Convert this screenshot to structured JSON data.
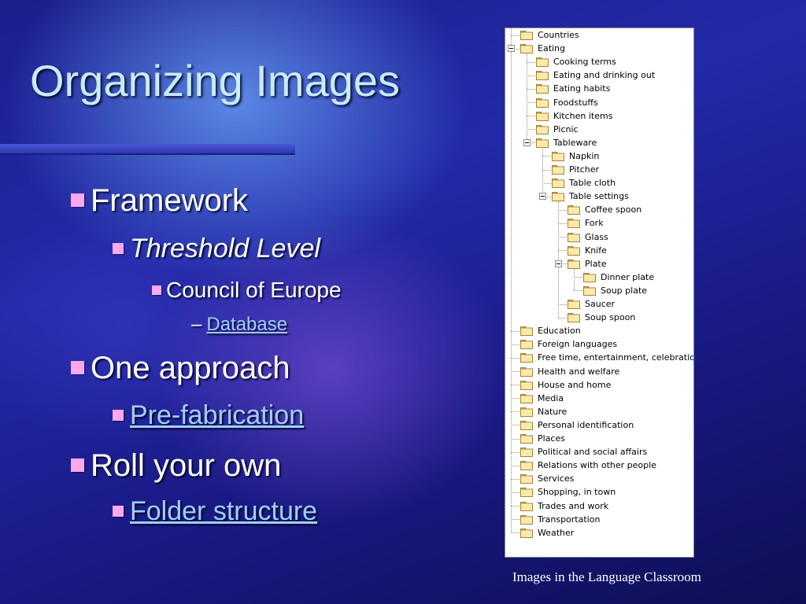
{
  "slide": {
    "title": "Organizing Images",
    "footer": "Images in the Language Classroom"
  },
  "bullets": {
    "framework": "Framework",
    "threshold": "Threshold Level",
    "council": "Council of Europe",
    "database": "Database",
    "one_approach": "One approach",
    "prefab": "Pre-fabrication",
    "roll_your_own": "Roll your own",
    "folder_structure": "Folder structure"
  },
  "colors": {
    "title_text": "#c9ecff",
    "bullet_square": "#ffa8ee",
    "link": "#9fd0ff",
    "background": "#1f25a0"
  },
  "tree": [
    {
      "label": "Countries",
      "depth": 0,
      "expanded": false
    },
    {
      "label": "Eating",
      "depth": 0,
      "expanded": true
    },
    {
      "label": "Cooking terms",
      "depth": 1,
      "expanded": false
    },
    {
      "label": "Eating and drinking out",
      "depth": 1,
      "expanded": false
    },
    {
      "label": "Eating habits",
      "depth": 1,
      "expanded": false
    },
    {
      "label": "Foodstuffs",
      "depth": 1,
      "expanded": false
    },
    {
      "label": "Kitchen items",
      "depth": 1,
      "expanded": false
    },
    {
      "label": "Picnic",
      "depth": 1,
      "expanded": false
    },
    {
      "label": "Tableware",
      "depth": 1,
      "expanded": true
    },
    {
      "label": "Napkin",
      "depth": 2,
      "expanded": false
    },
    {
      "label": "Pitcher",
      "depth": 2,
      "expanded": false
    },
    {
      "label": "Table cloth",
      "depth": 2,
      "expanded": false
    },
    {
      "label": "Table settings",
      "depth": 2,
      "expanded": true
    },
    {
      "label": "Coffee spoon",
      "depth": 3,
      "expanded": false
    },
    {
      "label": "Fork",
      "depth": 3,
      "expanded": false
    },
    {
      "label": "Glass",
      "depth": 3,
      "expanded": false
    },
    {
      "label": "Knife",
      "depth": 3,
      "expanded": false
    },
    {
      "label": "Plate",
      "depth": 3,
      "expanded": true
    },
    {
      "label": "Dinner plate",
      "depth": 4,
      "expanded": false
    },
    {
      "label": "Soup plate",
      "depth": 4,
      "expanded": false
    },
    {
      "label": "Saucer",
      "depth": 3,
      "expanded": false
    },
    {
      "label": "Soup spoon",
      "depth": 3,
      "expanded": false
    },
    {
      "label": "Education",
      "depth": 0,
      "expanded": false
    },
    {
      "label": "Foreign languages",
      "depth": 0,
      "expanded": false
    },
    {
      "label": "Free time, entertainment, celebrations",
      "depth": 0,
      "expanded": false
    },
    {
      "label": "Health and welfare",
      "depth": 0,
      "expanded": false
    },
    {
      "label": "House and home",
      "depth": 0,
      "expanded": false
    },
    {
      "label": "Media",
      "depth": 0,
      "expanded": false
    },
    {
      "label": "Nature",
      "depth": 0,
      "expanded": false
    },
    {
      "label": "Personal identification",
      "depth": 0,
      "expanded": false
    },
    {
      "label": "Places",
      "depth": 0,
      "expanded": false
    },
    {
      "label": "Political and social affairs",
      "depth": 0,
      "expanded": false
    },
    {
      "label": "Relations with other people",
      "depth": 0,
      "expanded": false
    },
    {
      "label": "Services",
      "depth": 0,
      "expanded": false
    },
    {
      "label": "Shopping, in town",
      "depth": 0,
      "expanded": false
    },
    {
      "label": "Trades and work",
      "depth": 0,
      "expanded": false
    },
    {
      "label": "Transportation",
      "depth": 0,
      "expanded": false
    },
    {
      "label": "Weather",
      "depth": 0,
      "expanded": false
    }
  ]
}
